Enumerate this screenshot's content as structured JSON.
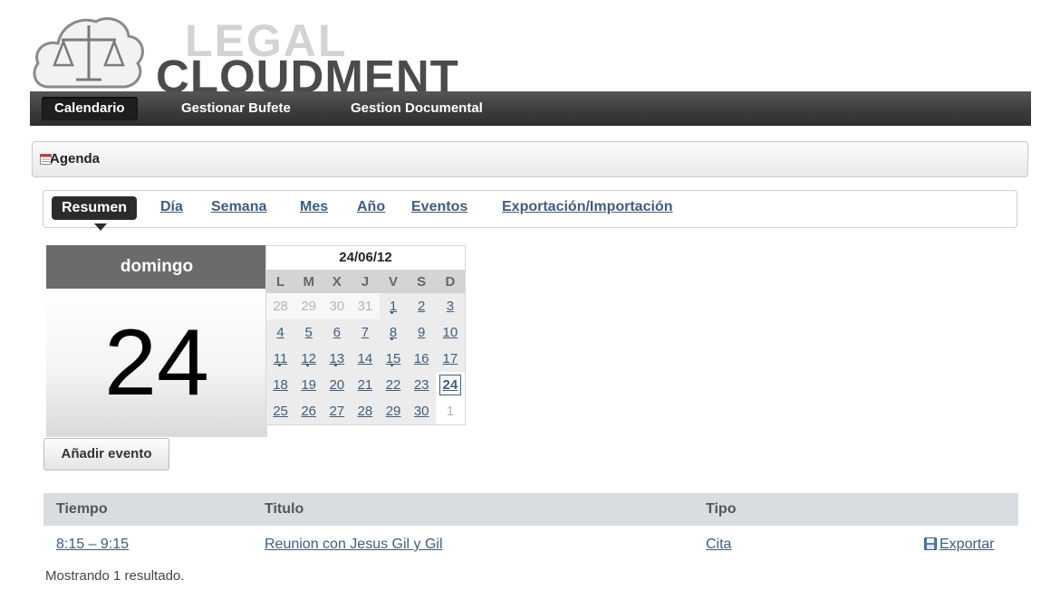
{
  "brand": {
    "line1": "LEGAL",
    "line2": "CLOUDMENT"
  },
  "nav": {
    "items": [
      {
        "label": "Calendario",
        "active": true
      },
      {
        "label": "Gestionar Bufete",
        "active": false
      },
      {
        "label": "Gestion Documental",
        "active": false
      }
    ]
  },
  "panel": {
    "title": "Agenda",
    "icon": "calendar-icon"
  },
  "tabs": [
    {
      "label": "Resumen",
      "active": true
    },
    {
      "label": "Día"
    },
    {
      "label": "Semana"
    },
    {
      "label": "Mes"
    },
    {
      "label": "Año"
    },
    {
      "label": "Eventos"
    },
    {
      "label": "Exportación/Importación"
    }
  ],
  "day": {
    "weekday": "domingo",
    "number": "24"
  },
  "mini_calendar": {
    "title": "24/06/12",
    "weekdays": [
      "L",
      "M",
      "X",
      "J",
      "V",
      "S",
      "D"
    ],
    "weeks": [
      [
        "28",
        "29",
        "30",
        "31",
        "1",
        "2",
        "3"
      ],
      [
        "4",
        "5",
        "6",
        "7",
        "8",
        "9",
        "10"
      ],
      [
        "11",
        "12",
        "13",
        "14",
        "15",
        "16",
        "17"
      ],
      [
        "18",
        "19",
        "20",
        "21",
        "22",
        "23",
        "24"
      ],
      [
        "25",
        "26",
        "27",
        "28",
        "29",
        "30",
        "1"
      ]
    ]
  },
  "actions": {
    "add_event": "Añadir evento"
  },
  "events": {
    "headers": {
      "time": "Tiempo",
      "title": "Titulo",
      "type": "Tipo"
    },
    "rows": [
      {
        "time": "8:15 – 9:15",
        "title": "Reunion con Jesus Gil y Gil",
        "type": "Cita",
        "export": "Exportar"
      }
    ],
    "status": "Mostrando 1 resultado."
  },
  "colors": {
    "navbar": "#3b3b3b",
    "link": "#3f5d7d",
    "day_header": "#6b6b6b"
  }
}
